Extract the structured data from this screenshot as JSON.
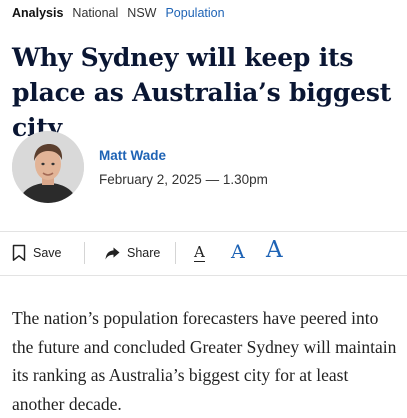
{
  "tags": [
    {
      "label": "Analysis"
    },
    {
      "label": "National"
    },
    {
      "label": "NSW"
    },
    {
      "label": "Population"
    }
  ],
  "article": {
    "headline": "Why Sydney will keep its place as Australia’s biggest city",
    "author": "Matt Wade",
    "date": "February 2, 2025 — 1.30pm",
    "body": "The nation’s population forecasters have peered into the future and concluded Greater Sydney will maintain its ranking as Australia’s biggest city for at least another decade."
  },
  "toolbar": {
    "save_label": "Save",
    "share_label": "Share",
    "font_small": "A",
    "font_medium": "A",
    "font_large": "A"
  },
  "colors": {
    "accent": "#1e63b5",
    "headline": "#0a1633",
    "text": "#222222"
  },
  "icons": [
    "bookmark-icon",
    "share-arrow-icon"
  ]
}
